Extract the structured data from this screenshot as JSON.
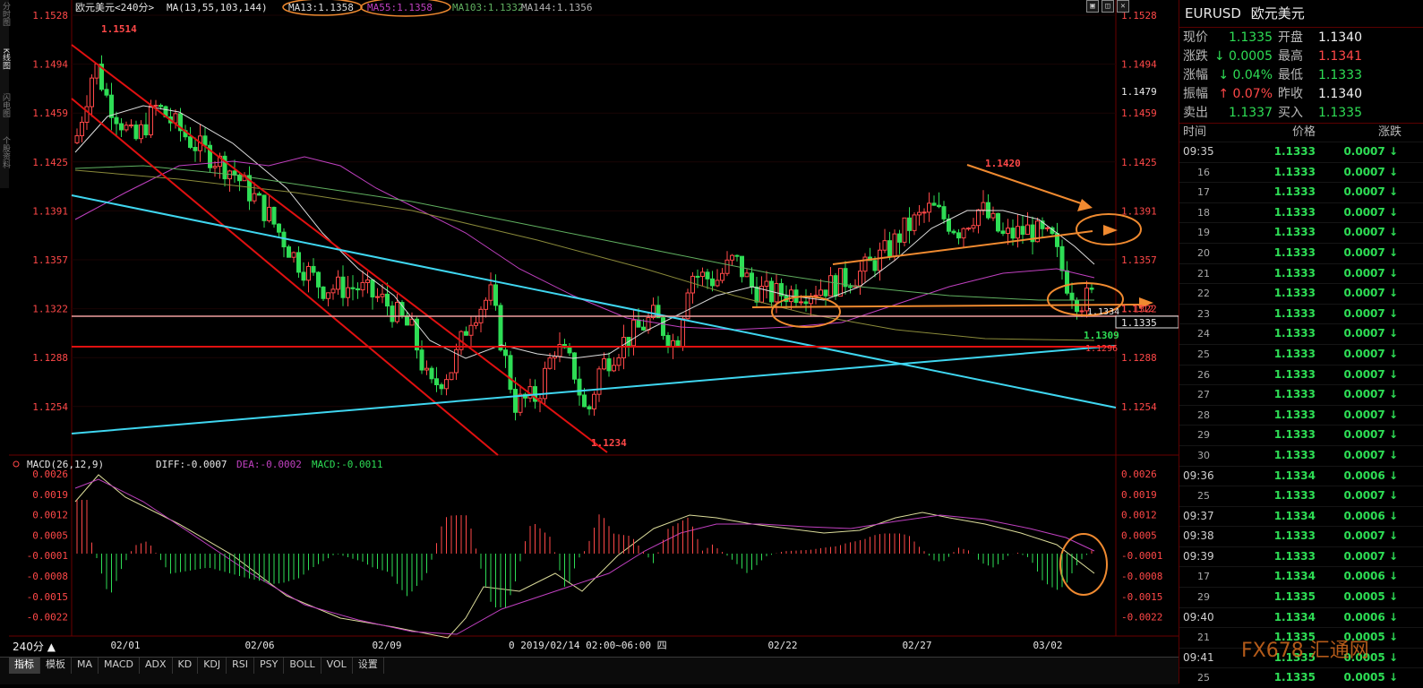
{
  "window": {
    "title": "欧元美元<240分>",
    "ma_legend": {
      "params": "MA(13,55,103,144)",
      "ma13": "MA13:1.1358",
      "ma55": "MA55:1.1358",
      "ma103": "MA103:1.1332",
      "ma144": "MA144:1.1356"
    },
    "left_rail": [
      "分时图",
      "K线图",
      "闪电图",
      "个股资料"
    ]
  },
  "price_axis": {
    "labels": [
      "1.1528",
      "1.1494",
      "1.1459",
      "1.1425",
      "1.1391",
      "1.1357",
      "1.1322",
      "1.1288",
      "1.1254"
    ],
    "current_box": "1.1335",
    "marker_1479": "1.1479"
  },
  "annotations": {
    "high": "1.1514",
    "low": "1.1234",
    "peak": "1.1420",
    "recent_low": "1.1309",
    "last_tag": "1.1334",
    "tag_1296": "1.1296",
    "tag_1312": "1.1312"
  },
  "macd": {
    "params": "MACD(26,12,9)",
    "diff": "DIFF:-0.0007",
    "dea": "DEA:-0.0002",
    "macd": "MACD:-0.0011",
    "labels": [
      "0.0026",
      "0.0019",
      "0.0012",
      "0.0005",
      "-0.0001",
      "-0.0008",
      "-0.0015",
      "-0.0022"
    ]
  },
  "x_axis": {
    "labels": [
      "02/01",
      "02/06",
      "02/09",
      "02/22",
      "02/27",
      "03/02"
    ],
    "cursor": "0 2019/02/14 02:00~06:00 四"
  },
  "bottom": {
    "period": "240分 ▲",
    "tabs": [
      "指标",
      "模板",
      "MA",
      "MACD",
      "ADX",
      "KD",
      "KDJ",
      "RSI",
      "PSY",
      "BOLL",
      "VOL",
      "设置"
    ]
  },
  "colors": {
    "up": "#ff4848",
    "down": "#2edd55",
    "channel": "#e01010",
    "trend_cyan": "#3fd6f0",
    "orange": "#f08a30",
    "ma13": "#dcdcdc",
    "ma55": "#c040c0",
    "ma103": "#60b060",
    "ma144": "#8a8a3a"
  },
  "side": {
    "code": "EURUSD",
    "name": "欧元美元",
    "quote": [
      {
        "l1": "现价",
        "v1": "1.1335",
        "c1": "green",
        "l2": "开盘",
        "v2": "1.1340",
        "c2": "white"
      },
      {
        "l1": "涨跌",
        "v1": "↓ 0.0005",
        "c1": "green",
        "l2": "最高",
        "v2": "1.1341",
        "c2": "red"
      },
      {
        "l1": "涨幅",
        "v1": "↓ 0.04%",
        "c1": "green",
        "l2": "最低",
        "v2": "1.1333",
        "c2": "green"
      },
      {
        "l1": "振幅",
        "v1": "↑ 0.07%",
        "c1": "red",
        "l2": "昨收",
        "v2": "1.1340",
        "c2": "white"
      },
      {
        "l1": "卖出",
        "v1": "1.1337",
        "c1": "green",
        "l2": "买入",
        "v2": "1.1335",
        "c2": "green"
      }
    ],
    "tick_header": [
      "时间",
      "价格",
      "涨跌"
    ],
    "ticks": [
      {
        "t": "09:35",
        "p": "1.1333",
        "c": "0.0007 ↓",
        "main": true
      },
      {
        "t": "16",
        "p": "1.1333",
        "c": "0.0007 ↓"
      },
      {
        "t": "17",
        "p": "1.1333",
        "c": "0.0007 ↓"
      },
      {
        "t": "18",
        "p": "1.1333",
        "c": "0.0007 ↓"
      },
      {
        "t": "19",
        "p": "1.1333",
        "c": "0.0007 ↓"
      },
      {
        "t": "20",
        "p": "1.1333",
        "c": "0.0007 ↓"
      },
      {
        "t": "21",
        "p": "1.1333",
        "c": "0.0007 ↓"
      },
      {
        "t": "22",
        "p": "1.1333",
        "c": "0.0007 ↓"
      },
      {
        "t": "23",
        "p": "1.1333",
        "c": "0.0007 ↓"
      },
      {
        "t": "24",
        "p": "1.1333",
        "c": "0.0007 ↓"
      },
      {
        "t": "25",
        "p": "1.1333",
        "c": "0.0007 ↓"
      },
      {
        "t": "26",
        "p": "1.1333",
        "c": "0.0007 ↓"
      },
      {
        "t": "27",
        "p": "1.1333",
        "c": "0.0007 ↓"
      },
      {
        "t": "28",
        "p": "1.1333",
        "c": "0.0007 ↓"
      },
      {
        "t": "29",
        "p": "1.1333",
        "c": "0.0007 ↓"
      },
      {
        "t": "30",
        "p": "1.1333",
        "c": "0.0007 ↓"
      },
      {
        "t": "09:36",
        "p": "1.1334",
        "c": "0.0006 ↓",
        "main": true
      },
      {
        "t": "25",
        "p": "1.1333",
        "c": "0.0007 ↓"
      },
      {
        "t": "09:37",
        "p": "1.1334",
        "c": "0.0006 ↓",
        "main": true
      },
      {
        "t": "09:38",
        "p": "1.1333",
        "c": "0.0007 ↓",
        "main": true
      },
      {
        "t": "09:39",
        "p": "1.1333",
        "c": "0.0007 ↓",
        "main": true
      },
      {
        "t": "17",
        "p": "1.1334",
        "c": "0.0006 ↓"
      },
      {
        "t": "29",
        "p": "1.1335",
        "c": "0.0005 ↓"
      },
      {
        "t": "09:40",
        "p": "1.1334",
        "c": "0.0006 ↓",
        "main": true
      },
      {
        "t": "21",
        "p": "1.1335",
        "c": "0.0005 ↓"
      },
      {
        "t": "09:41",
        "p": "1.1335",
        "c": "0.0005 ↓",
        "main": true
      },
      {
        "t": "25",
        "p": "1.1335",
        "c": "0.0005 ↓"
      }
    ]
  },
  "watermark": "FX678 汇通网"
}
